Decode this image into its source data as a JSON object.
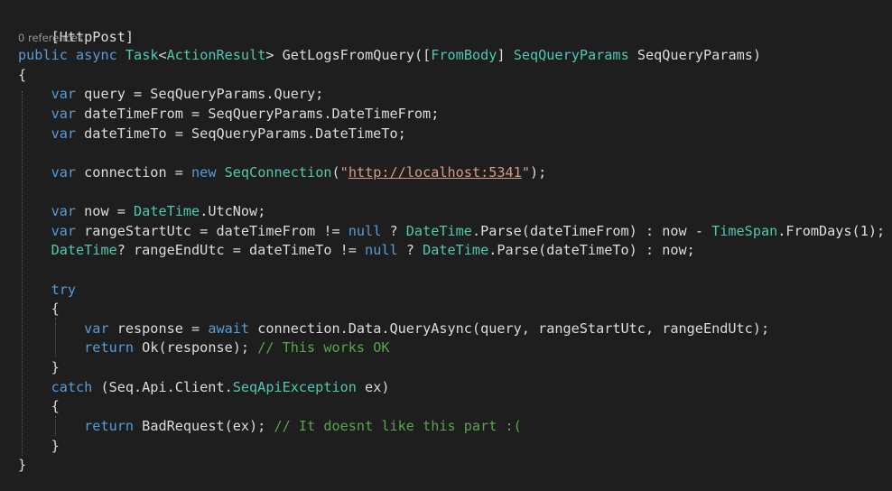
{
  "code": {
    "attribute": "[HttpPost]",
    "codelens": "0 references",
    "sig": {
      "mod1": "public",
      "mod2": "async",
      "task": "Task",
      "lt": "<",
      "action_result": "ActionResult",
      "gt_method": "> GetLogsFromQuery([",
      "from_body": "FromBody",
      "close_attr": "] ",
      "param_type": "SeqQueryParams",
      "param_tail": " SeqQueryParams)"
    },
    "brace_open": "{",
    "brace_close": "}",
    "var": "var",
    "line_query": " query = SeqQueryParams.Query;",
    "line_dtfrom": " dateTimeFrom = SeqQueryParams.DateTimeFrom;",
    "line_dtto": " dateTimeTo = SeqQueryParams.DateTimeTo;",
    "conn": {
      "pre": " connection = ",
      "new_kw": "new",
      "space": " ",
      "type": "SeqConnection",
      "open": "(",
      "q1": "\"",
      "url": "http://localhost:5341",
      "q2": "\"",
      "close": ");"
    },
    "now_line": {
      "pre": " now = ",
      "type": "DateTime",
      "post": ".UtcNow;"
    },
    "start_line": {
      "pre": " rangeStartUtc = dateTimeFrom != ",
      "null": "null",
      "q": " ? ",
      "type": "DateTime",
      "mid": ".Parse(dateTimeFrom) : now - ",
      "type2": "TimeSpan",
      "post": ".FromDays(1);"
    },
    "end_line": {
      "type": "DateTime",
      "pre": "? rangeEndUtc = dateTimeTo != ",
      "null": "null",
      "q": " ? ",
      "type2": "DateTime",
      "post": ".Parse(dateTimeTo) : now;"
    },
    "try": "try",
    "resp_line": {
      "pre": " response = ",
      "await": "await",
      "post": " connection.Data.QueryAsync(query, rangeStartUtc, rangeEndUtc);"
    },
    "ok_line": {
      "ret": "return",
      "code": " Ok(response); ",
      "comment": "// This works OK"
    },
    "catch_line": {
      "kw": "catch",
      "pre": " (Seq.Api.Client.",
      "type": "SeqApiException",
      "post": " ex)"
    },
    "bad_line": {
      "ret": "return",
      "code": " BadRequest(ex); ",
      "comment": "// It doesnt like this part :("
    }
  }
}
